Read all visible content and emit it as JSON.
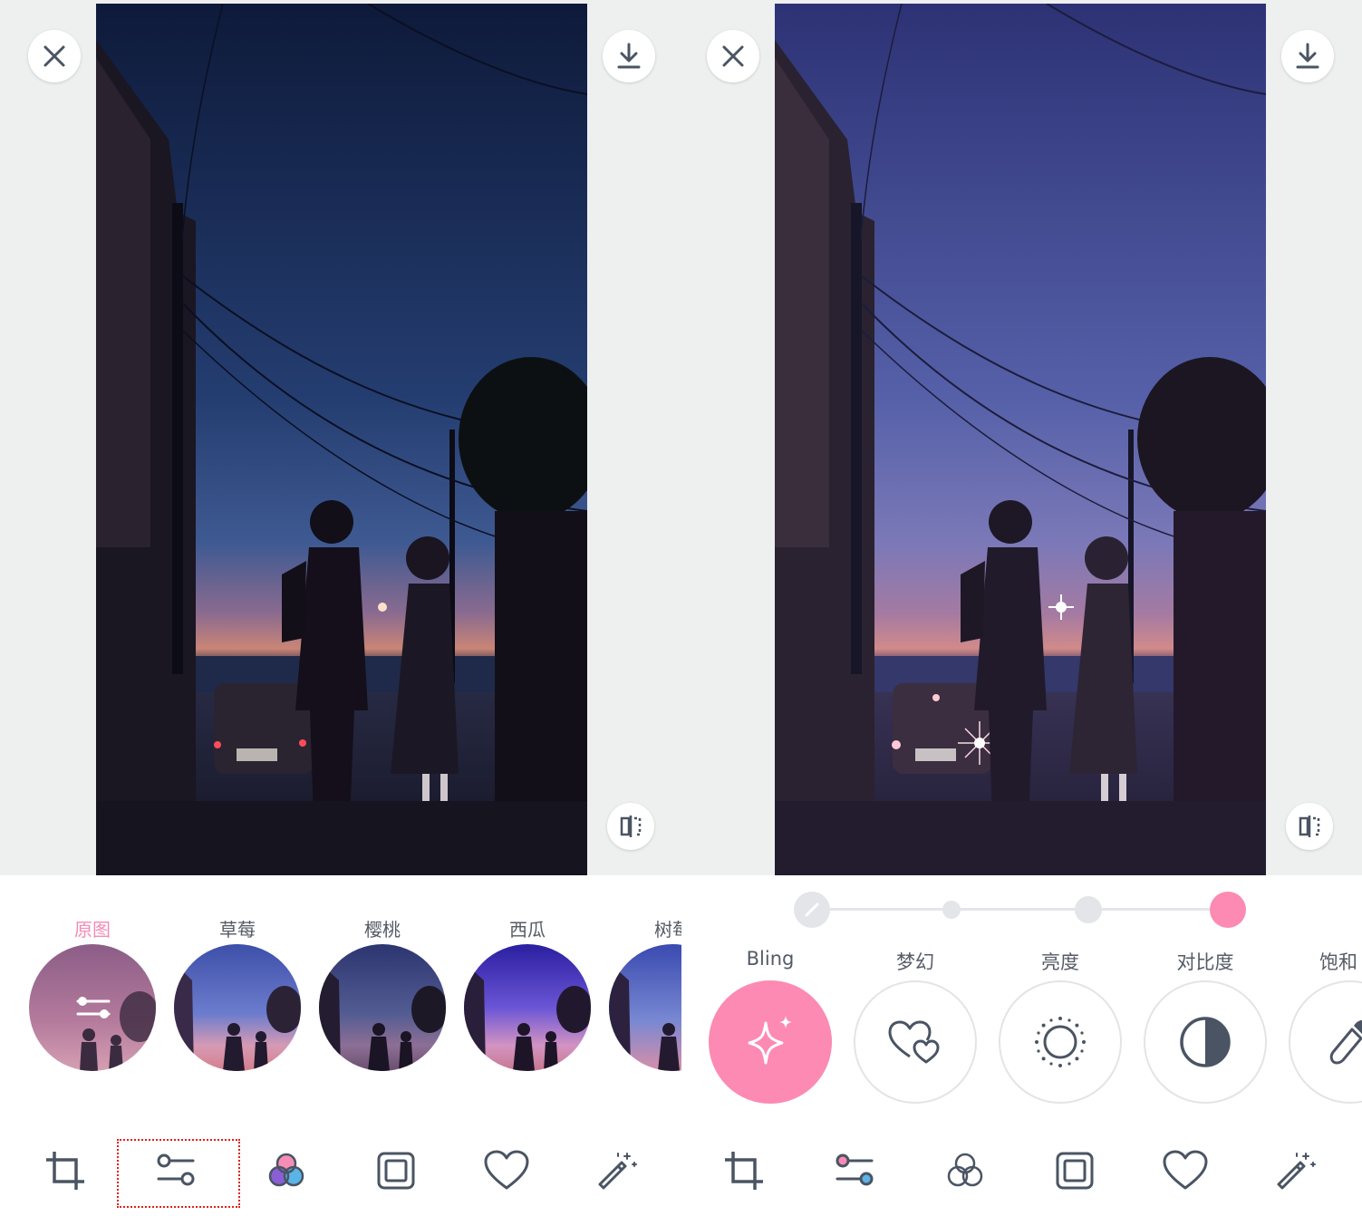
{
  "left": {
    "filters": [
      {
        "label": "原图",
        "active": true
      },
      {
        "label": "草莓",
        "active": false
      },
      {
        "label": "樱桃",
        "active": false
      },
      {
        "label": "西瓜",
        "active": false
      },
      {
        "label": "树莓",
        "active": false
      }
    ],
    "toolbar": [
      "crop-icon",
      "sliders-icon",
      "color-filter-icon",
      "frame-icon",
      "heart-icon",
      "magic-wand-icon"
    ],
    "selected_tool": "sliders-icon"
  },
  "right": {
    "intensity": {
      "steps": 4,
      "selected": 4,
      "accent": "#fc8ab2"
    },
    "adjustments": [
      {
        "label": "Bling",
        "icon": "sparkle-icon",
        "active": true
      },
      {
        "label": "梦幻",
        "icon": "hearts-icon",
        "active": false
      },
      {
        "label": "亮度",
        "icon": "brightness-icon",
        "active": false
      },
      {
        "label": "对比度",
        "icon": "contrast-icon",
        "active": false
      },
      {
        "label": "饱和",
        "icon": "dropper-icon",
        "active": false
      }
    ],
    "toolbar": [
      "crop-icon",
      "sliders-icon",
      "color-filter-icon",
      "frame-icon",
      "heart-icon",
      "magic-wand-icon"
    ]
  },
  "colors": {
    "accent": "#fc8ab2",
    "icon": "#4a5463",
    "sky_top": "#0f1e40"
  }
}
